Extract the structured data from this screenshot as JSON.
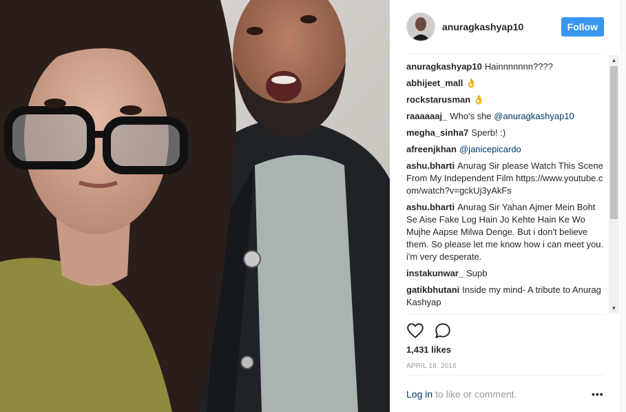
{
  "post": {
    "username": "anuragkashyap10",
    "follow_label": "Follow",
    "likes": "1,431 likes",
    "date": "APRIL 18, 2016",
    "login_link": "Log in",
    "login_text": "to like or comment.",
    "more_label": "•••"
  },
  "comments": [
    {
      "user": "anuragkashyap10",
      "text": "Hainnnnnnn????",
      "mention": ""
    },
    {
      "user": "abhijeet_mall",
      "text": "👌",
      "mention": ""
    },
    {
      "user": "rockstarusman",
      "text": "👌",
      "mention": ""
    },
    {
      "user": "raaaaaaj_",
      "text": "Who's she",
      "mention": "@anuragkashyap10"
    },
    {
      "user": "megha_sinha7",
      "text": "Sperb! :)",
      "mention": ""
    },
    {
      "user": "afreenjkhan",
      "text": "",
      "mention": "@janicepicardo"
    },
    {
      "user": "ashu.bharti",
      "text": "Anurag Sir please Watch This Scene From My Independent Film https://www.youtube.com/watch?v=gckUj3yAkFs",
      "mention": ""
    },
    {
      "user": "ashu.bharti",
      "text": "Anurag Sir Yahan Ajmer Mein Boht Se Aise Fake Log Hain Jo Kehte Hain Ke Wo Mujhe Aapse Milwa Denge. But i don't believe them. So please let me know how i can meet you. i'm very desperate.",
      "mention": ""
    },
    {
      "user": "instakunwar_",
      "text": "Supb",
      "mention": ""
    },
    {
      "user": "gatikbhutani",
      "text": "Inside my mind- A tribute to Anurag Kashyap",
      "mention": ""
    }
  ],
  "colors": {
    "accent": "#3897f0",
    "link": "#003569",
    "muted": "#999999"
  },
  "icons": {
    "like": "heart-icon",
    "comment": "comment-bubble-icon",
    "more": "more-options-icon"
  }
}
